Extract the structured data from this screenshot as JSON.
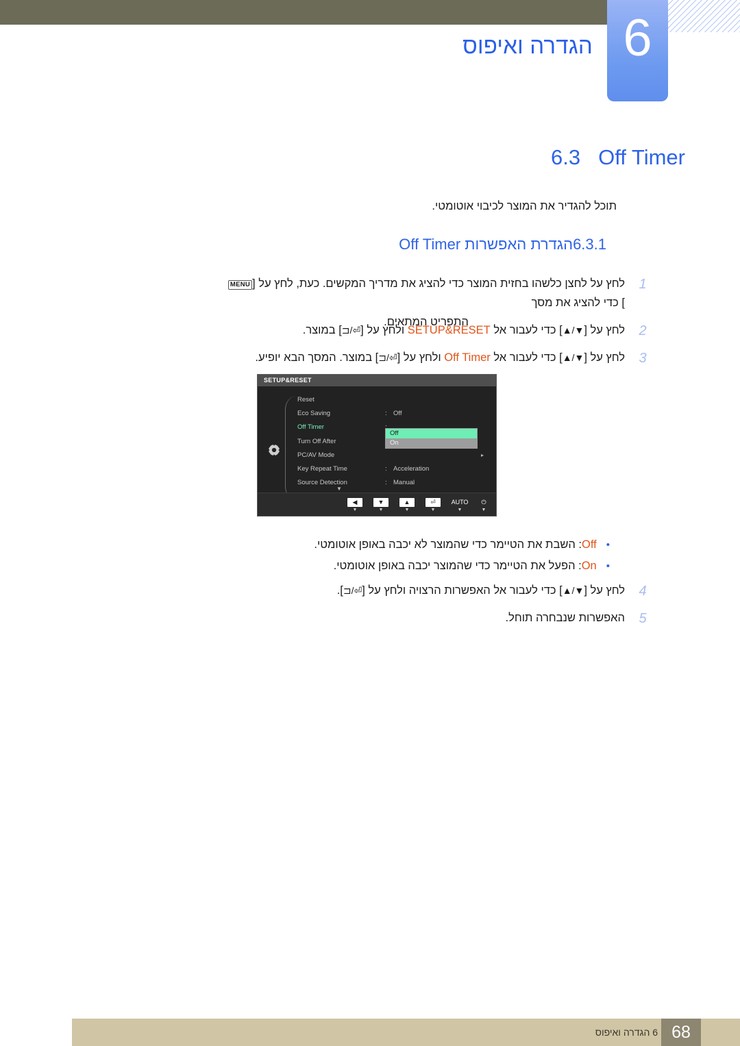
{
  "header": {
    "chapter_number": "6",
    "chapter_title": "הגדרה ואיפוס"
  },
  "section": {
    "number": "6.3",
    "title": "Off Timer",
    "intro": "תוכל להגדיר את המוצר לכיבוי אוטומטי."
  },
  "subsection": {
    "number": "6.3.1",
    "title": "הגדרת האפשרות Off Timer"
  },
  "steps": [
    {
      "number": "1",
      "line1_a": "לחץ על לחצן כלשהו בחזית המוצר כדי להציג את מדריך המקשים. כעת, לחץ על [",
      "menu_key": "MENU",
      "line1_b": "] כדי להציג את מסך",
      "line2": "התפריט המתאים."
    },
    {
      "number": "2",
      "a": "לחץ על [",
      "updown": "▲/▼",
      "b": "] כדי לעבור אל ",
      "keyword": "SETUP&RESET",
      "c": " ולחץ על [",
      "enter_keys": "⊐/⏎",
      "d": "] במוצר."
    },
    {
      "number": "3",
      "a": "לחץ על [",
      "updown": "▲/▼",
      "b": "] כדי לעבור אל ",
      "keyword": "Off Timer",
      "c": " ולחץ על [",
      "enter_keys": "⊐/⏎",
      "d": "] במוצר. המסך הבא יופיע."
    },
    {
      "number": "4",
      "a": "לחץ על [",
      "updown": "▲/▼",
      "b": "] כדי לעבור אל האפשרות הרצויה ולחץ על [",
      "enter_keys": "⊐/⏎",
      "c": "]."
    },
    {
      "number": "5",
      "text": "האפשרות שנבחרה תוחל."
    }
  ],
  "osd": {
    "title": "SETUP&RESET",
    "rows": [
      {
        "label": "Reset",
        "colon": "",
        "value": "",
        "arrow": ""
      },
      {
        "label": "Eco Saving",
        "colon": ":",
        "value": "Off",
        "arrow": ""
      },
      {
        "label": "Off Timer",
        "colon": ":",
        "value": "",
        "arrow": ""
      },
      {
        "label": "Turn Off After",
        "colon": "",
        "value": "",
        "arrow": ""
      },
      {
        "label": "PC/AV Mode",
        "colon": "",
        "value": "",
        "arrow": "▸"
      },
      {
        "label": "Key Repeat Time",
        "colon": ":",
        "value": "Acceleration",
        "arrow": ""
      },
      {
        "label": "Source Detection",
        "colon": ":",
        "value": "Manual",
        "arrow": ""
      }
    ],
    "selected_row_index": 2,
    "popup_options": [
      {
        "label": "Off",
        "state": "highlighted"
      },
      {
        "label": "On",
        "state": "normal"
      }
    ],
    "scroll_indicator": "▼",
    "buttons": [
      {
        "icon": "◀",
        "tick": "▼",
        "boxed": true
      },
      {
        "icon": "▼",
        "tick": "▼",
        "boxed": true
      },
      {
        "icon": "▲",
        "tick": "▼",
        "boxed": true
      },
      {
        "icon": "⏎",
        "tick": "▼",
        "boxed": true
      },
      {
        "icon": "AUTO",
        "tick": "▼",
        "boxed": false
      },
      {
        "icon": "⏻",
        "tick": "▼",
        "boxed": false
      }
    ],
    "highlight_color": "#6eedb4"
  },
  "bullets": [
    {
      "keyword": "Off",
      "text": ": השבת את הטיימר כדי שהמוצר לא יכבה באופן אוטומטי."
    },
    {
      "keyword": "On",
      "text": ": הפעל את הטיימר כדי שהמוצר יכבה באופן אוטומטי."
    }
  ],
  "footer": {
    "text": "6 הגדרה ואיפוס",
    "page_number": "68"
  }
}
